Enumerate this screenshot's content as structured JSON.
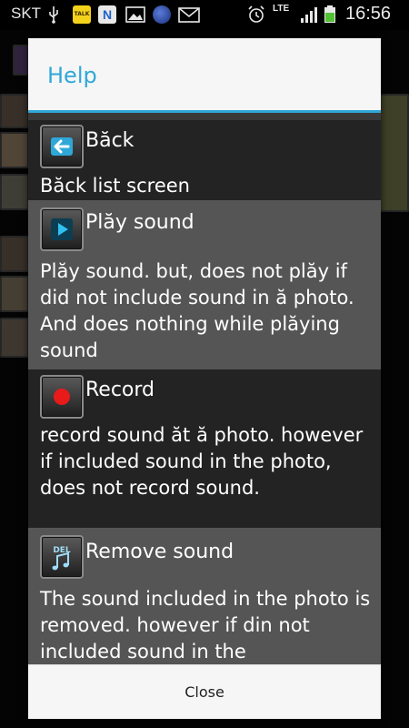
{
  "status_bar": {
    "carrier": "SKT",
    "network_type": "LTE",
    "clock": "16:56",
    "icons": [
      "usb-icon",
      "kakaotalk-icon",
      "n-app-icon",
      "gallery-icon",
      "globe-icon",
      "mail-icon",
      "alarm-icon",
      "signal-icon",
      "battery-icon"
    ],
    "talk_label": "TALK",
    "n_label": "N"
  },
  "dialog": {
    "title": "Help",
    "accent_color": "#2fa8d8",
    "items": [
      {
        "icon": "back-arrow-icon",
        "title": "Băck",
        "description": "Băck list screen"
      },
      {
        "icon": "play-icon",
        "title": "Plăy sound",
        "description": "Plăy sound. but, does not plăy if did not include sound in ă photo. And does nothing while plăying sound"
      },
      {
        "icon": "record-icon",
        "title": "Record",
        "description": "record sound ăt ă photo. however if included sound in the photo, does not record sound."
      },
      {
        "icon": "delete-sound-icon",
        "title": "Remove sound",
        "icon_label": "DEL",
        "description": "The sound included in the photo is removed. however if din not included sound in the"
      }
    ],
    "close_label": "Close"
  }
}
